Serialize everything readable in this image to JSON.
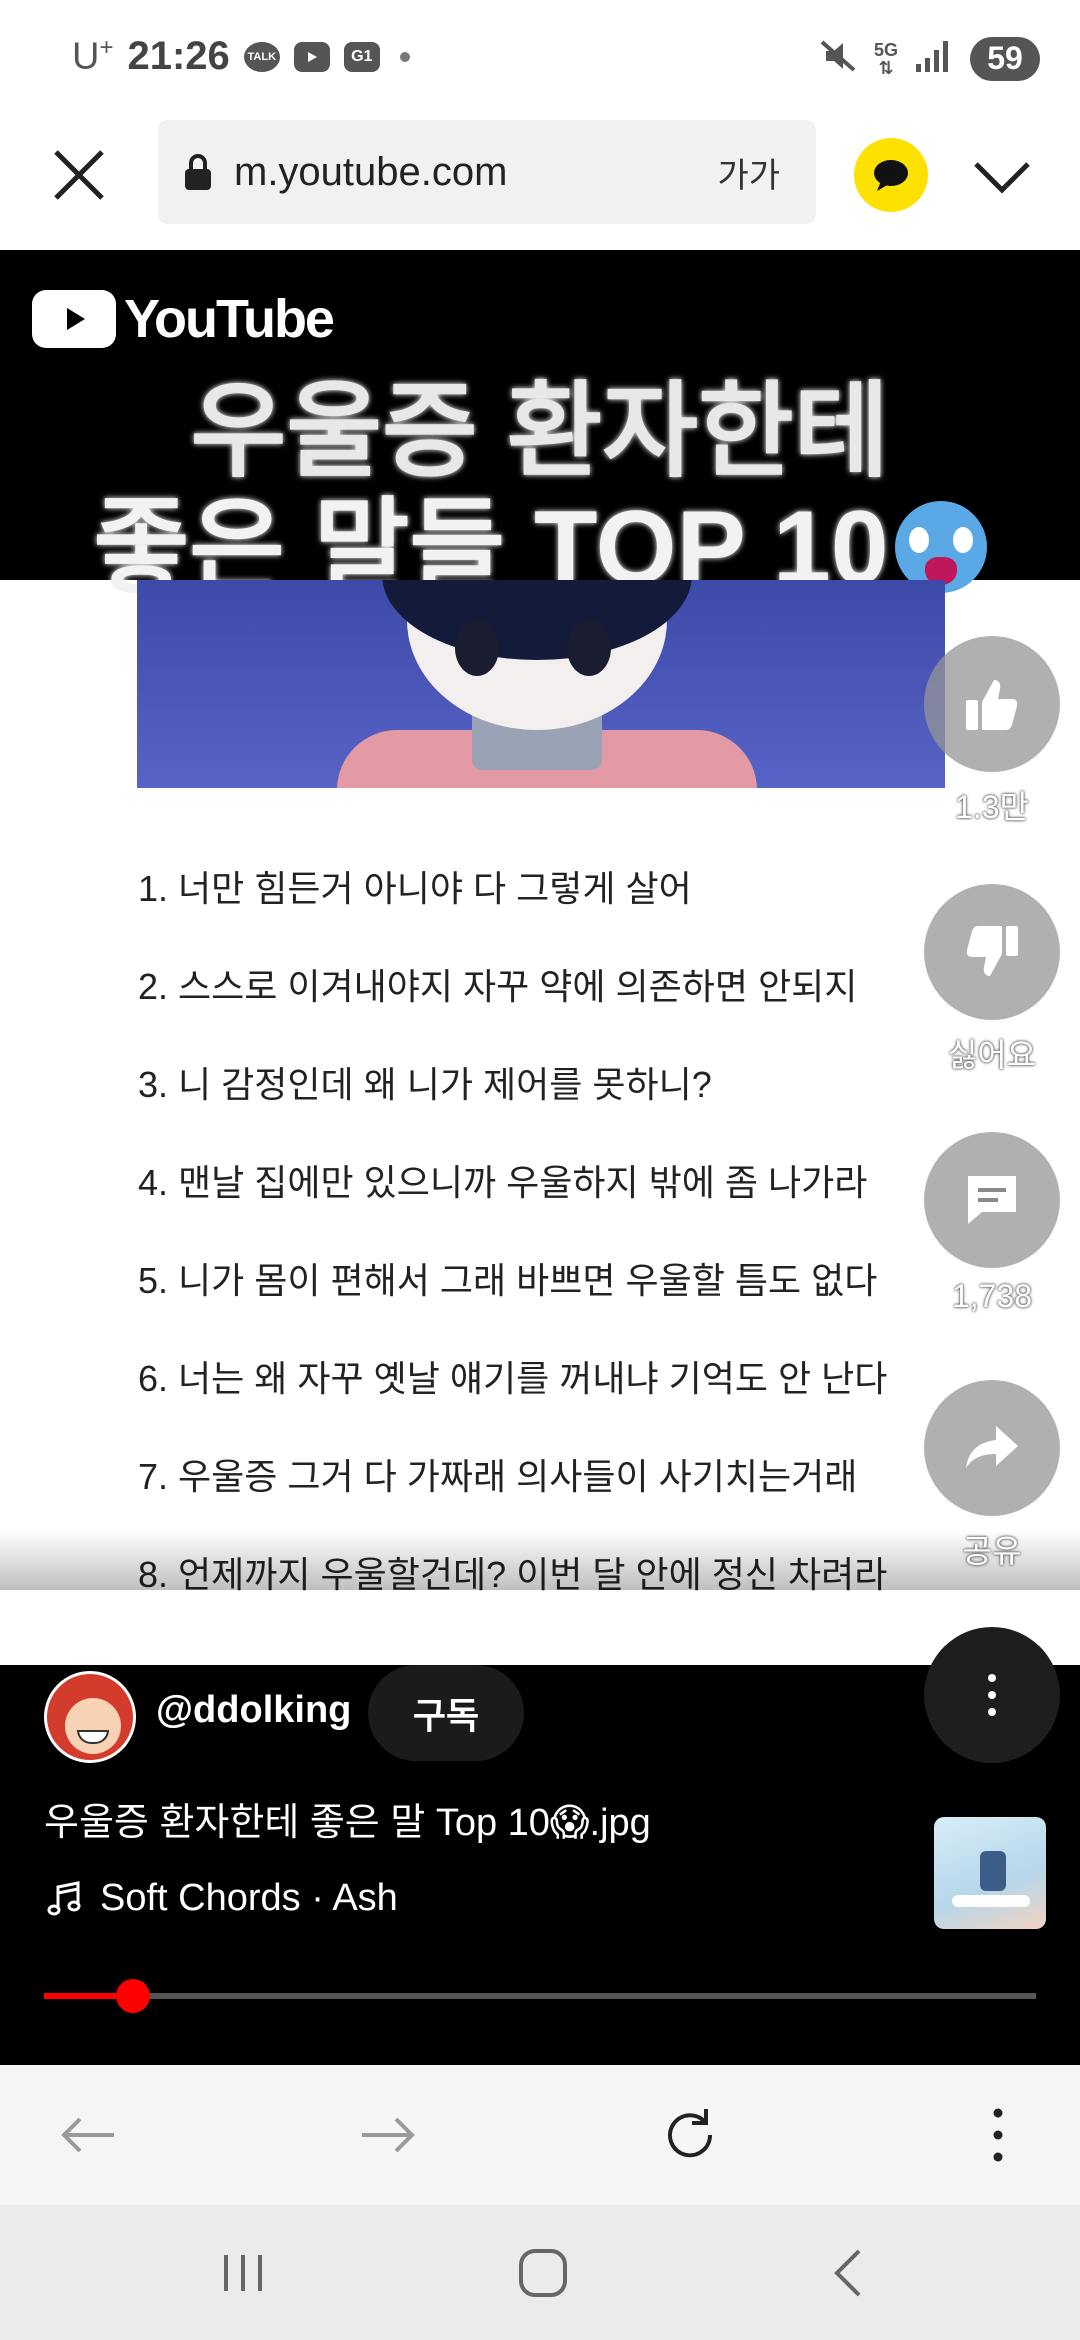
{
  "status_bar": {
    "carrier": "U",
    "carrier_sup": "+",
    "time": "21:26",
    "notif_talk": "TALK",
    "notif_app": "G1",
    "network": "5G",
    "battery": "59"
  },
  "browser": {
    "url": "m.youtube.com",
    "text_size_label": "가가"
  },
  "video": {
    "brand": "YouTube",
    "title_line1": "우울증 환자한테",
    "title_line2": "좋은 말들 TOP 10",
    "list_items": [
      "1. 너만 힘든거 아니야 다 그렇게 살어",
      "2. 스스로 이겨내야지 자꾸 약에 의존하면 안되지",
      "3. 니 감정인데 왜 니가 제어를 못하니?",
      "4. 맨날 집에만 있으니까 우울하지 밖에 좀 나가라",
      "5. 니가 몸이 편해서 그래 바쁘면 우울할 틈도 없다",
      "6. 너는 왜 자꾸 옛날 얘기를 꺼내냐 기억도 안 난다",
      "7. 우울증 그거 다 가짜래 의사들이 사기치는거래",
      "8. 언제까지 우울할건데? 이번 달 안에 정신 차려라"
    ]
  },
  "actions": {
    "like_count": "1.3만",
    "dislike_label": "싫어요",
    "comment_count": "1,738",
    "share_label": "공유"
  },
  "channel": {
    "handle": "@ddolking",
    "subscribe_label": "구독"
  },
  "short": {
    "title": "우울증 환자한테 좋은 말 Top 10😱.jpg",
    "music": "Soft Chords · Ash",
    "progress": 0.09
  },
  "colors": {
    "progress": "#ff0000",
    "talk_button": "#fde100"
  }
}
